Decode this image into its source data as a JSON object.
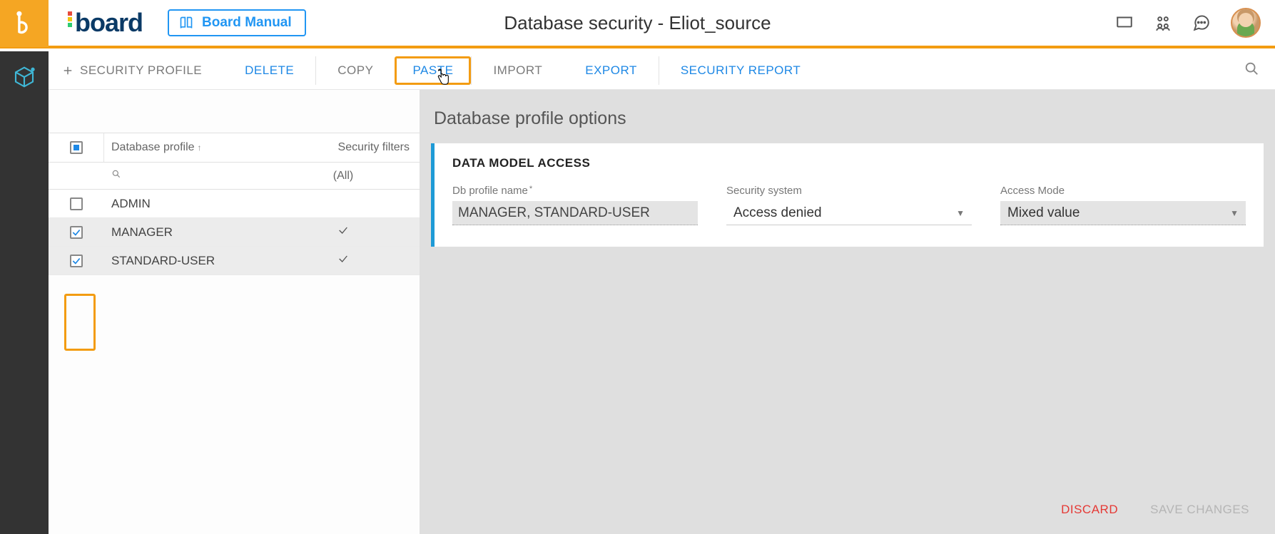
{
  "header": {
    "brand": "board",
    "manual_button": "Board Manual",
    "page_title": "Database security - Eliot_source"
  },
  "toolbar": {
    "add_label": "SECURITY PROFILE",
    "delete": "DELETE",
    "copy": "COPY",
    "paste": "PASTE",
    "import": "IMPORT",
    "export": "EXPORT",
    "security_report": "SECURITY REPORT"
  },
  "grid": {
    "header_profile": "Database profile",
    "header_filters": "Security filters",
    "filter_all": "(All)",
    "rows": [
      {
        "name": "ADMIN",
        "checked": false,
        "has_filter": false
      },
      {
        "name": "MANAGER",
        "checked": true,
        "has_filter": true
      },
      {
        "name": "STANDARD-USER",
        "checked": true,
        "has_filter": true
      }
    ]
  },
  "panel": {
    "title": "Database profile options",
    "section": "DATA MODEL ACCESS",
    "db_profile_label": "Db profile name",
    "db_profile_value": "MANAGER, STANDARD-USER",
    "security_system_label": "Security system",
    "security_system_value": "Access denied",
    "access_mode_label": "Access Mode",
    "access_mode_value": "Mixed value"
  },
  "footer": {
    "discard": "DISCARD",
    "save": "SAVE CHANGES"
  }
}
